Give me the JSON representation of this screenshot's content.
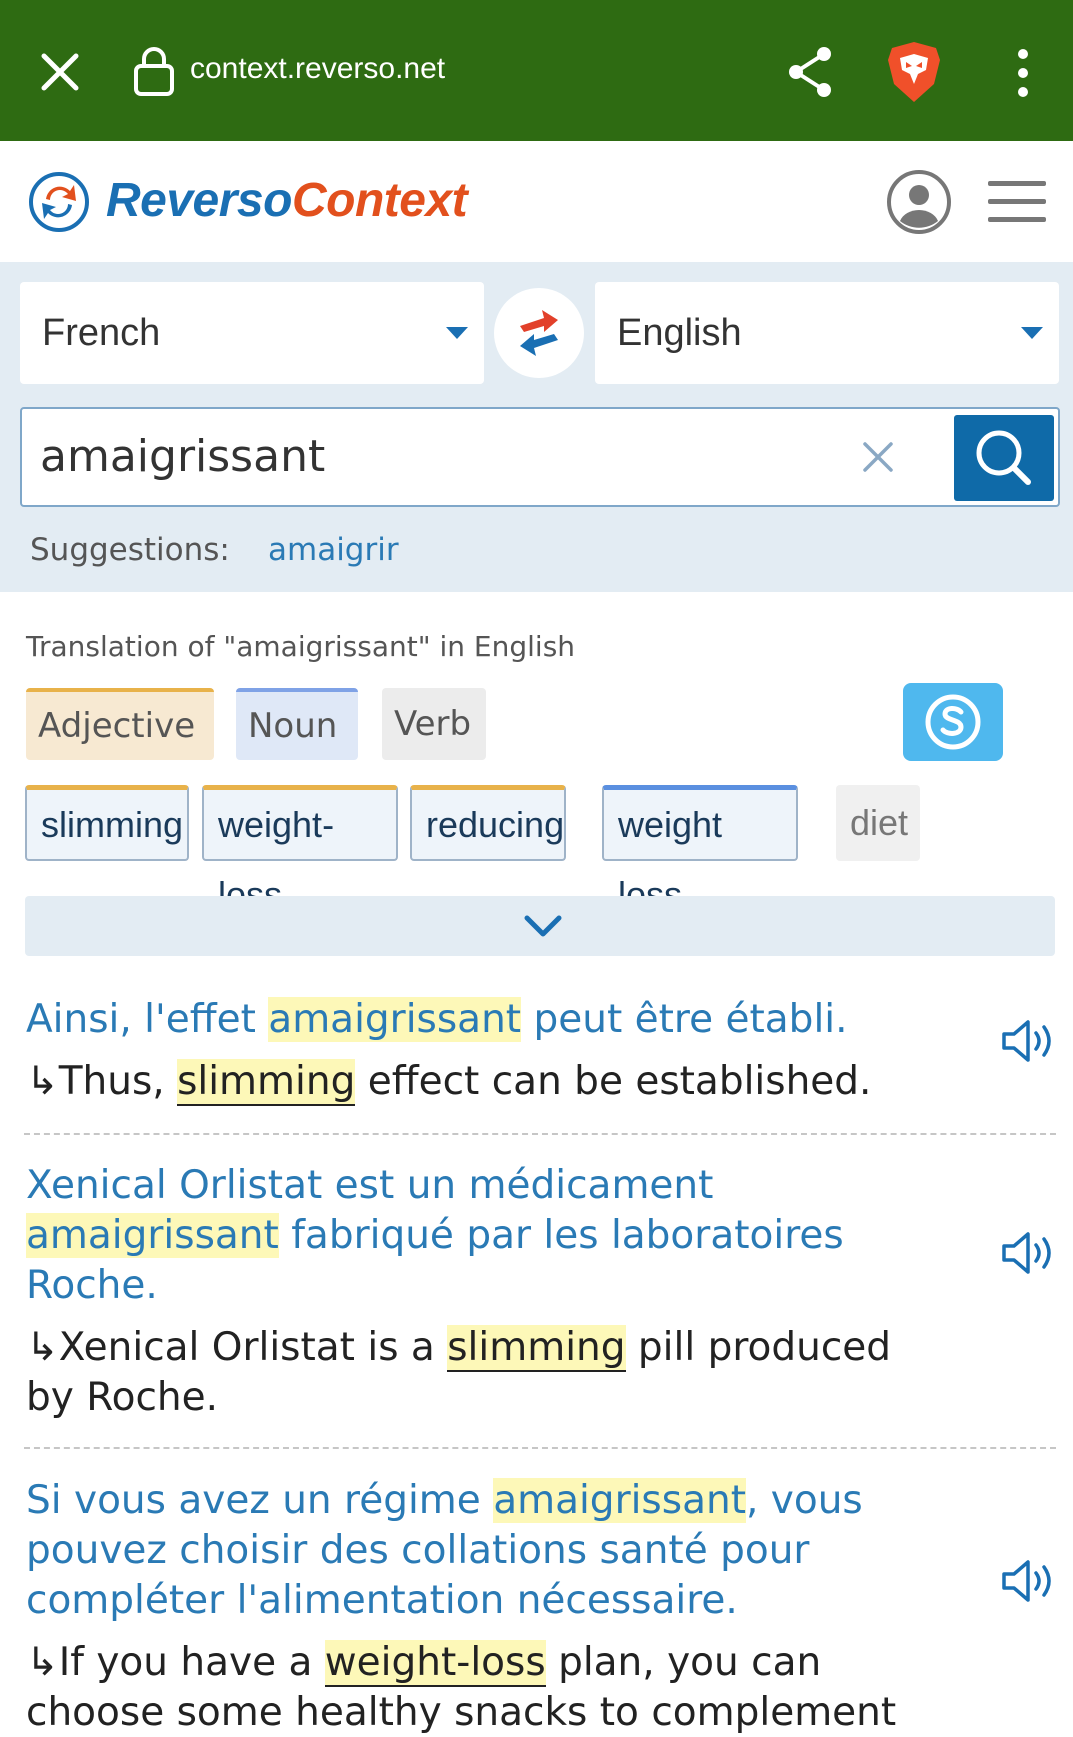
{
  "browser": {
    "url": "context.reverso.net"
  },
  "brand": {
    "name_part1": "Reverso",
    "name_part2": "Context"
  },
  "search": {
    "source_language": "French",
    "target_language": "English",
    "query": "amaigrissant",
    "suggestions_label": "Suggestions:",
    "suggestion": "amaigrir"
  },
  "results": {
    "title": "Translation of \"amaigrissant\" in English",
    "parts_of_speech": [
      "Adjective",
      "Noun",
      "Verb"
    ],
    "translations": [
      "slimming",
      "weight-loss",
      "reducing",
      "weight loss",
      "diet"
    ]
  },
  "examples": [
    {
      "src_before": "Ainsi, l'effet ",
      "src_hl": "amaigrissant",
      "src_after": " peut être établi.",
      "tgt_arrow": "↳",
      "tgt_before": "Thus, ",
      "tgt_hl": "slimming",
      "tgt_after": " effect can be established."
    },
    {
      "src_before": "Xenical Orlistat est un médicament ",
      "src_hl": "amaigrissant",
      "src_after": " fabriqué par les laboratoires Roche.",
      "tgt_arrow": "↳",
      "tgt_before": "Xenical Orlistat is a ",
      "tgt_hl": "slimming",
      "tgt_after": " pill produced by Roche."
    },
    {
      "src_before": "Si vous avez un régime ",
      "src_hl": "amaigrissant",
      "src_after": ", vous pouvez choisir des collations santé pour compléter l'alimentation nécessaire.",
      "tgt_arrow": "↳",
      "tgt_before": "If you have a ",
      "tgt_hl": "weight-loss",
      "tgt_after": " plan, you can choose some healthy snacks to complement"
    }
  ],
  "colors": {
    "browser_bar": "#2e6b12",
    "brand_blue": "#1a6fb3",
    "brand_orange": "#e2501d",
    "highlight": "#fdf8b8"
  }
}
